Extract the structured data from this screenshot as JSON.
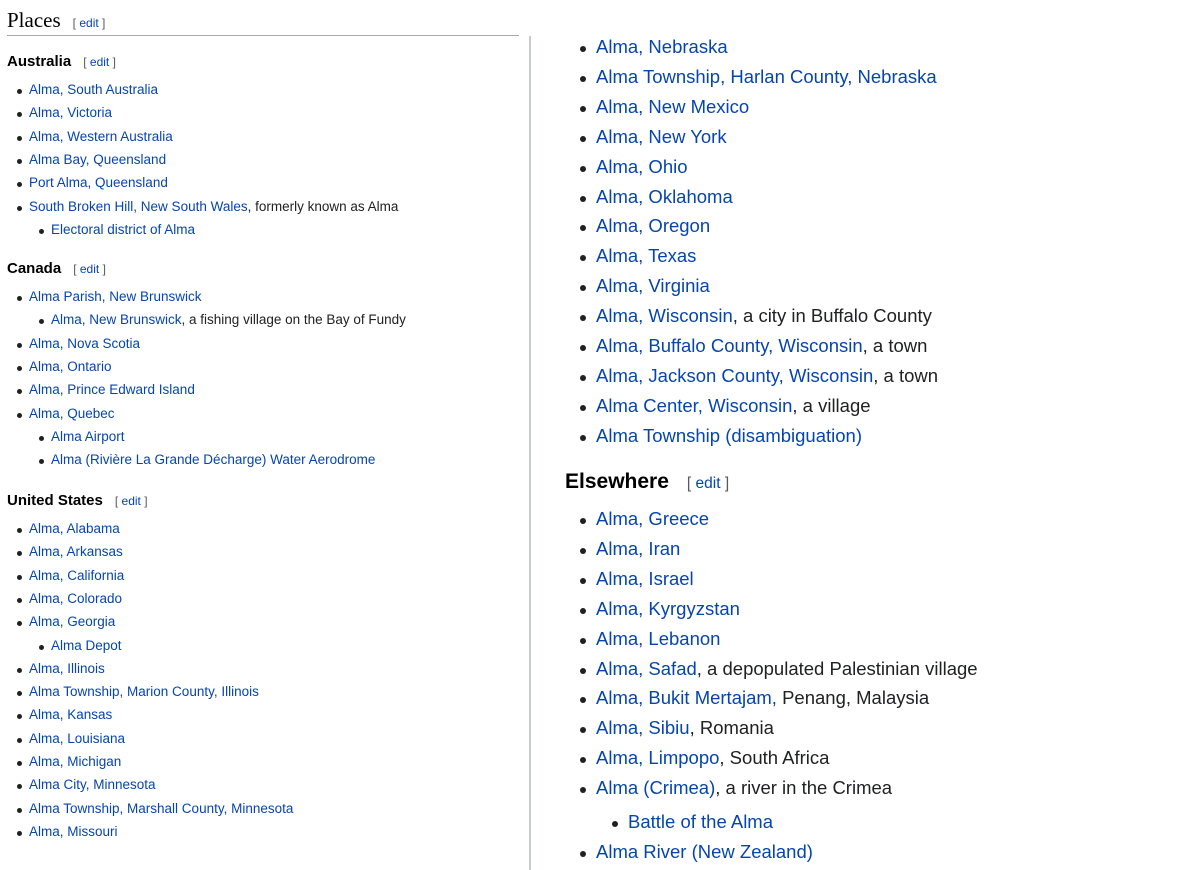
{
  "places": {
    "title": "Places",
    "edit_label": "edit",
    "bracket_open": "[",
    "bracket_close": "]"
  },
  "left": {
    "australia": {
      "heading": "Australia",
      "items": [
        {
          "link": "Alma, South Australia",
          "rest": ""
        },
        {
          "link": "Alma, Victoria",
          "rest": ""
        },
        {
          "link": "Alma, Western Australia",
          "rest": ""
        },
        {
          "link": "Alma Bay, Queensland",
          "rest": ""
        },
        {
          "link": "Port Alma, Queensland",
          "rest": ""
        },
        {
          "link": "South Broken Hill, New South Wales",
          "rest": ", formerly known as Alma"
        },
        {
          "link": "Electoral district of Alma",
          "rest": "",
          "sub": true
        }
      ]
    },
    "canada": {
      "heading": "Canada",
      "items": [
        {
          "link": "Alma Parish, New Brunswick",
          "rest": ""
        },
        {
          "link": "Alma, New Brunswick",
          "rest": ", a fishing village on the Bay of Fundy",
          "sub": true
        },
        {
          "link": "Alma, Nova Scotia",
          "rest": ""
        },
        {
          "link": "Alma, Ontario",
          "rest": ""
        },
        {
          "link": "Alma, Prince Edward Island",
          "rest": ""
        },
        {
          "link": "Alma, Quebec",
          "rest": ""
        },
        {
          "link": "Alma Airport",
          "rest": "",
          "sub": true
        },
        {
          "link": "Alma (Rivière La Grande Décharge) Water Aerodrome",
          "rest": "",
          "sub": true
        }
      ]
    },
    "united_states": {
      "heading": "United States",
      "items": [
        {
          "link": "Alma, Alabama",
          "rest": ""
        },
        {
          "link": "Alma, Arkansas",
          "rest": ""
        },
        {
          "link": "Alma, California",
          "rest": ""
        },
        {
          "link": "Alma, Colorado",
          "rest": ""
        },
        {
          "link": "Alma, Georgia",
          "rest": ""
        },
        {
          "link": "Alma Depot",
          "rest": "",
          "sub": true
        },
        {
          "link": "Alma, Illinois",
          "rest": ""
        },
        {
          "link": "Alma Township, Marion County, Illinois",
          "rest": ""
        },
        {
          "link": "Alma, Kansas",
          "rest": ""
        },
        {
          "link": "Alma, Louisiana",
          "rest": ""
        },
        {
          "link": "Alma, Michigan",
          "rest": ""
        },
        {
          "link": "Alma City, Minnesota",
          "rest": ""
        },
        {
          "link": "Alma Township, Marshall County, Minnesota",
          "rest": ""
        },
        {
          "link": "Alma, Missouri",
          "rest": ""
        }
      ]
    }
  },
  "right": {
    "us_continued": [
      {
        "link": "Alma, Nebraska",
        "rest": ""
      },
      {
        "link": "Alma Township, Harlan County, Nebraska",
        "rest": ""
      },
      {
        "link": "Alma, New Mexico",
        "rest": ""
      },
      {
        "link": "Alma, New York",
        "rest": ""
      },
      {
        "link": "Alma, Ohio",
        "rest": ""
      },
      {
        "link": "Alma, Oklahoma",
        "rest": ""
      },
      {
        "link": "Alma, Oregon",
        "rest": ""
      },
      {
        "link": "Alma, Texas",
        "rest": ""
      },
      {
        "link": "Alma, Virginia",
        "rest": ""
      },
      {
        "link": "Alma, Wisconsin",
        "rest": ", a city in Buffalo County"
      },
      {
        "link": "Alma, Buffalo County, Wisconsin",
        "rest": ", a town"
      },
      {
        "link": "Alma, Jackson County, Wisconsin",
        "rest": ", a town"
      },
      {
        "link": "Alma Center, Wisconsin",
        "rest": ", a village"
      },
      {
        "link": "Alma Township (disambiguation)",
        "rest": ""
      }
    ],
    "elsewhere": {
      "heading": "Elsewhere",
      "items": [
        {
          "link": "Alma, Greece",
          "rest": ""
        },
        {
          "link": "Alma, Iran",
          "rest": ""
        },
        {
          "link": "Alma, Israel",
          "rest": ""
        },
        {
          "link": "Alma, Kyrgyzstan",
          "rest": ""
        },
        {
          "link": "Alma, Lebanon",
          "rest": ""
        },
        {
          "link": "Alma, Safad",
          "rest": ", a depopulated Palestinian village"
        },
        {
          "link": "Alma, Bukit Mertajam,",
          "rest": " Penang, Malaysia"
        },
        {
          "link": "Alma, Sibiu",
          "rest": ", Romania"
        },
        {
          "link": "Alma, Limpopo",
          "rest": ", South Africa"
        },
        {
          "link": "Alma (Crimea)",
          "rest": ", a river in the Crimea"
        },
        {
          "link": "Battle of the Alma",
          "rest": "",
          "sub": true
        },
        {
          "link": "Alma River (New Zealand)",
          "rest": ""
        }
      ]
    }
  }
}
